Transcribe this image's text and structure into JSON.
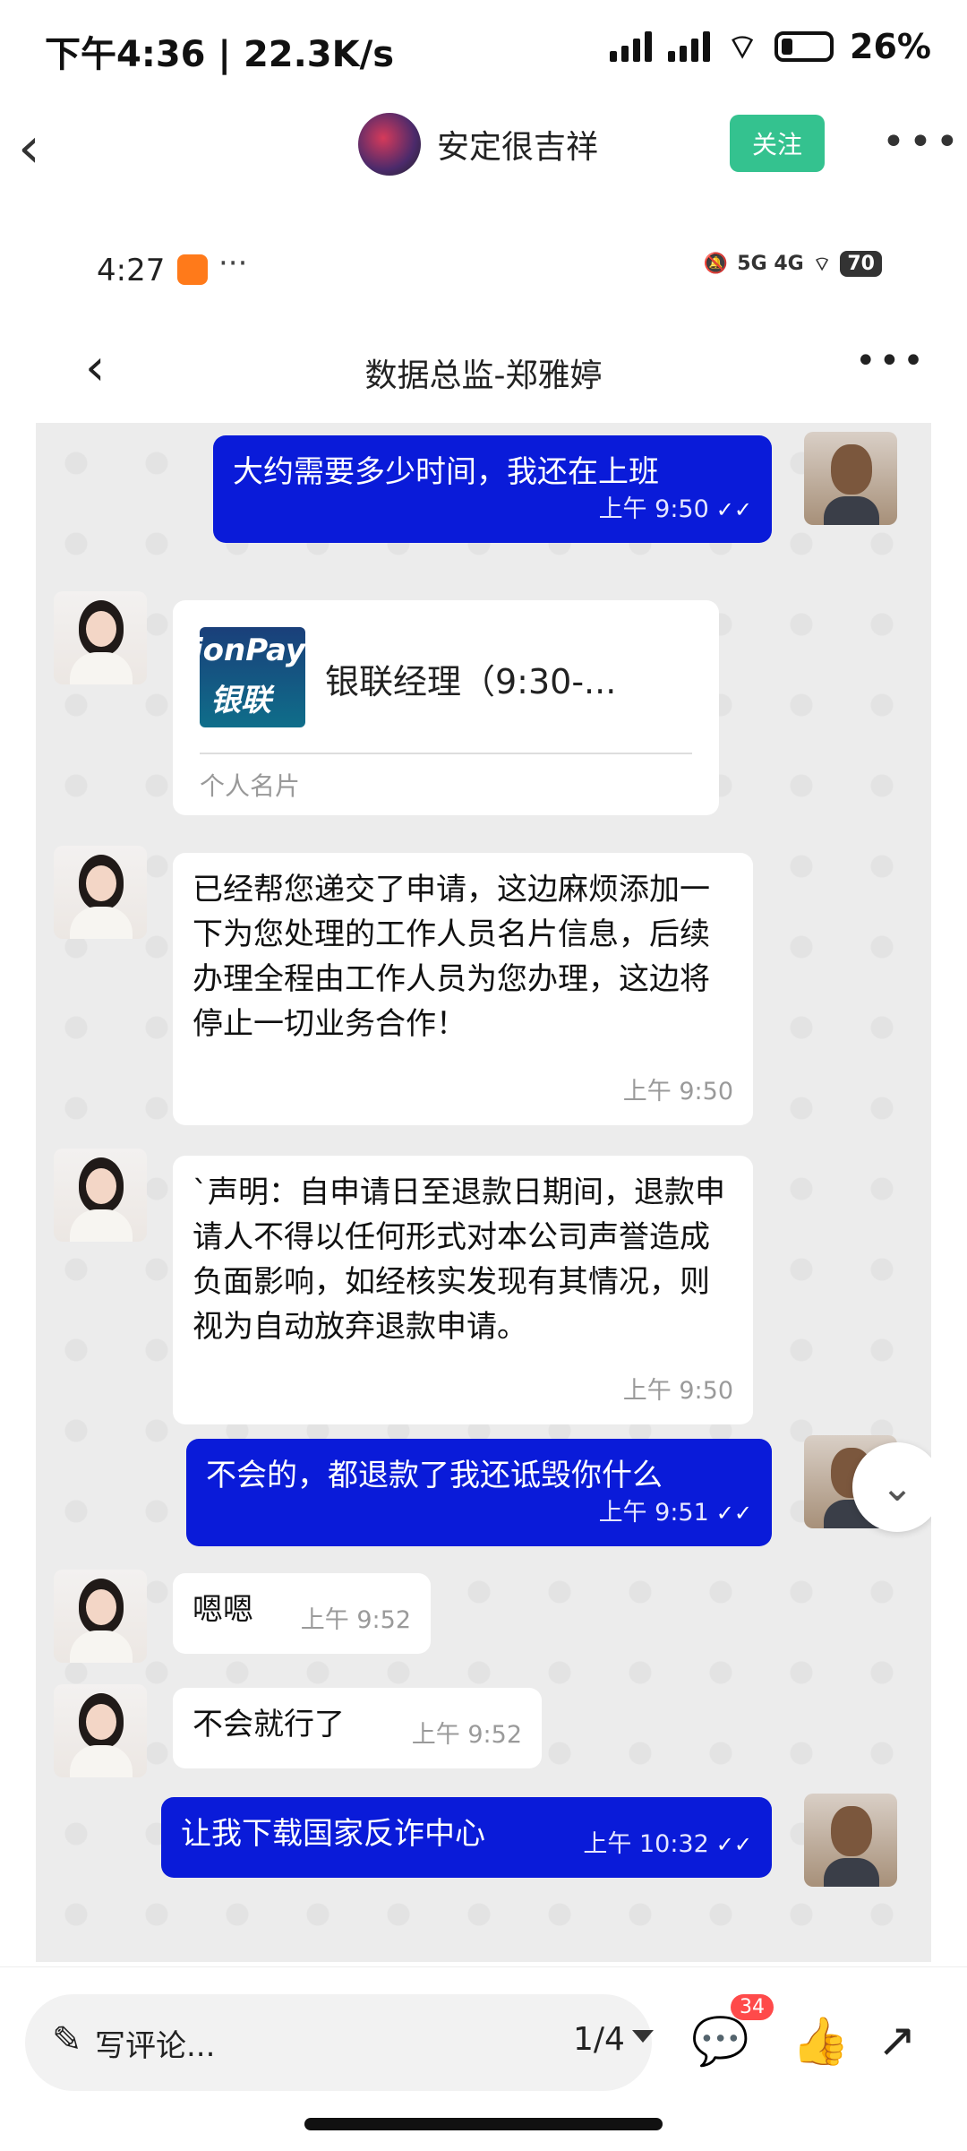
{
  "status_bar": {
    "left_text": "下午4:36 | 22.3K/s",
    "battery": "26%"
  },
  "header": {
    "author_name": "安定很吉祥",
    "follow_label": "关注"
  },
  "embedded": {
    "status": {
      "time": "4:27",
      "battery": "70",
      "network": "5G 4G"
    },
    "chat_title": "数据总监-郑雅婷",
    "messages": [
      {
        "text": "大约需要多少时间，我还在上班",
        "time": "上午 9:50"
      },
      {
        "card_name": "银联经理（9:30-...",
        "card_sub": "个人名片",
        "logo_top": "ionPay",
        "logo_bottom": "银联"
      },
      {
        "text": "已经帮您递交了申请，这边麻烦添加一下为您处理的工作人员名片信息，后续办理全程由工作人员为您办理，这边将停止一切业务合作！",
        "time": "上午 9:50"
      },
      {
        "text": "`声明：自申请日至退款日期间，退款申请人不得以任何形式对本公司声誉造成负面影响，如经核实发现有其情况，则视为自动放弃退款申请。",
        "time": "上午 9:50"
      },
      {
        "text": "不会的，都退款了我还诋毁你什么",
        "time": "上午 9:51"
      },
      {
        "text": "嗯嗯",
        "time": "上午 9:52"
      },
      {
        "text": "不会就行了",
        "time": "上午 9:52"
      },
      {
        "text": "让我下载国家反诈中心",
        "time": "上午 10:32"
      }
    ]
  },
  "bottom_bar": {
    "comment_placeholder": "写评论...",
    "pager": "1/4",
    "comment_count": "34"
  }
}
